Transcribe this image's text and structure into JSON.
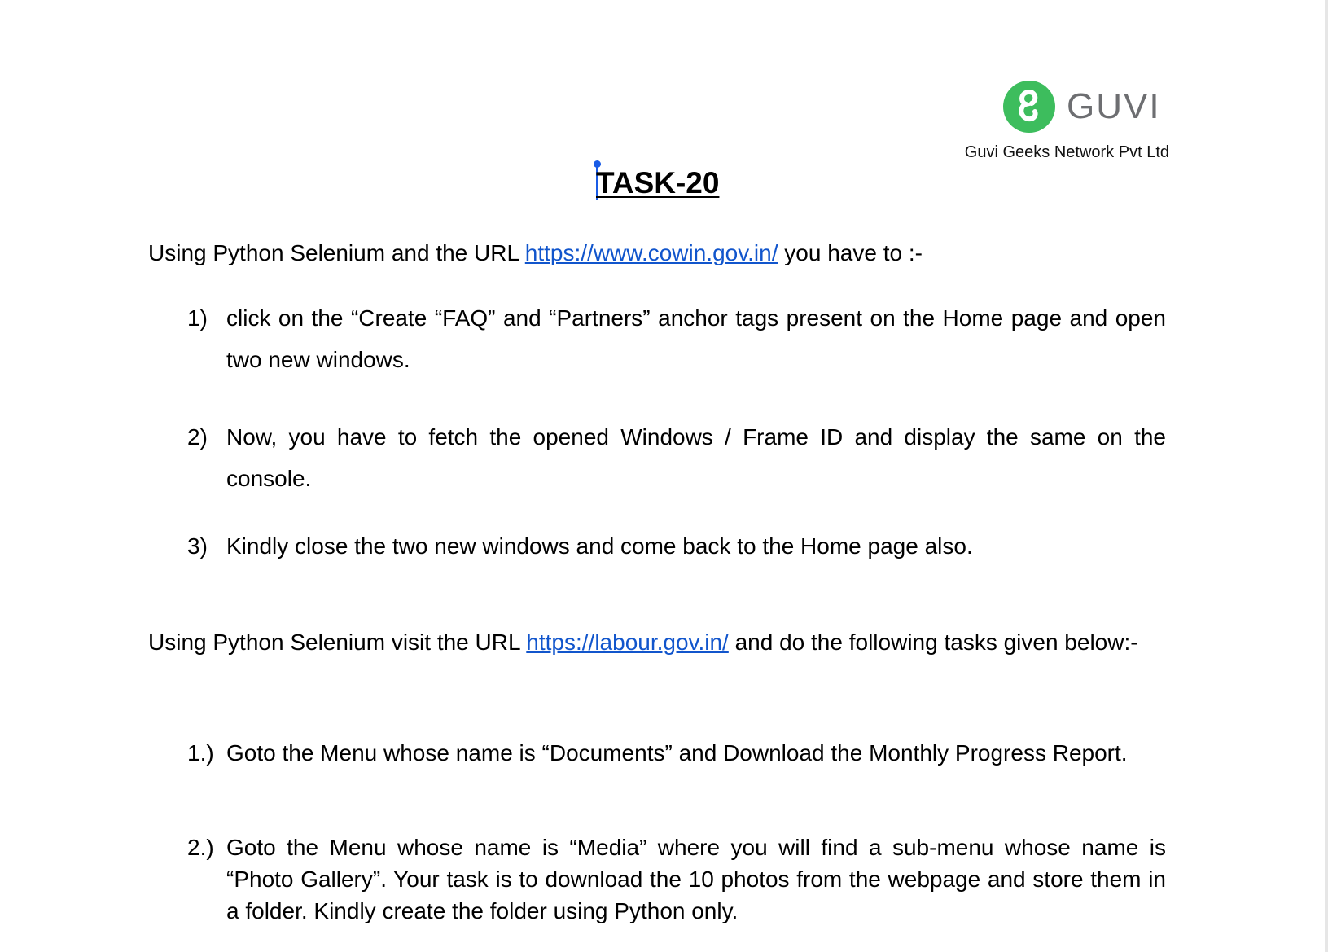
{
  "header": {
    "logo_text": "GUVI",
    "company_name": "Guvi Geeks Network Pvt Ltd",
    "colors": {
      "logo_green": "#3dbd5d",
      "logo_gray": "#6d6e71",
      "link_blue": "#1155cc",
      "cursor_blue": "#1a5ce6"
    }
  },
  "title": "TASK-20",
  "section1": {
    "intro_before": "Using Python Selenium and the URL ",
    "url": "https://www.cowin.gov.in/",
    "intro_after": " you have to :-",
    "items": [
      {
        "num": "1)",
        "text": " click on the “Create “FAQ” and “Partners” anchor tags present on the Home page and open two new windows."
      },
      {
        "num": "2)",
        "text": "Now, you have to fetch the opened Windows / Frame ID and display the same on the console."
      },
      {
        "num": "3)",
        "text": "Kindly close the two new windows and come back to the Home page also."
      }
    ]
  },
  "section2": {
    "intro_before": "Using Python Selenium visit the URL ",
    "url": "https://labour.gov.in/",
    "intro_after": " and do the following tasks given below:-",
    "items": [
      {
        "num": "1.)",
        "text": "Goto the Menu whose name is “Documents” and Download the Monthly Progress Report."
      },
      {
        "num": "2.)",
        "text": "Goto the Menu whose name is “Media” where you will find a sub-menu whose name is “Photo Gallery”. Your task is to download the 10 photos from the webpage and store them in a folder. Kindly create the folder using Python only."
      }
    ]
  }
}
